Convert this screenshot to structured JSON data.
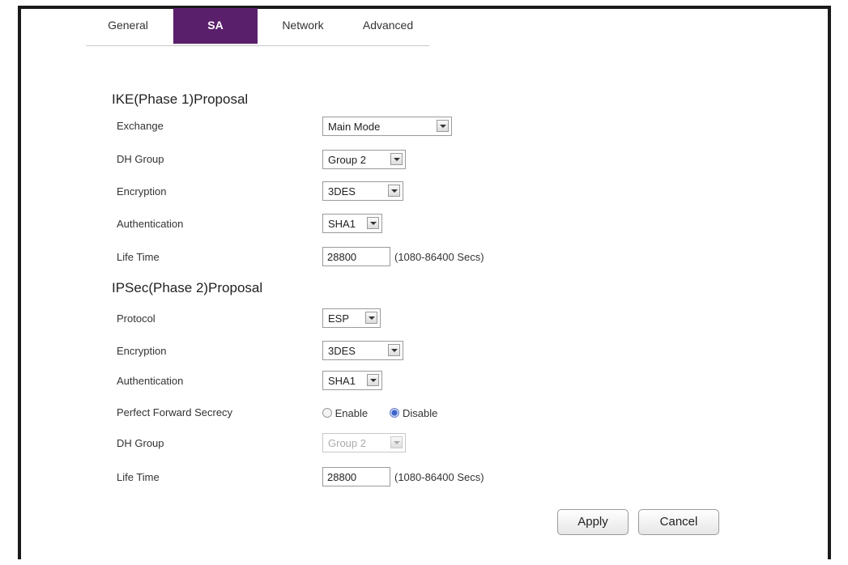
{
  "tabs": [
    {
      "label": "General",
      "active": false
    },
    {
      "label": "SA",
      "active": true
    },
    {
      "label": "Network",
      "active": false
    },
    {
      "label": "Advanced",
      "active": false
    }
  ],
  "ike": {
    "title": "IKE(Phase 1)Proposal",
    "exchange": {
      "label": "Exchange",
      "value": "Main Mode"
    },
    "dh_group": {
      "label": "DH Group",
      "value": "Group 2"
    },
    "encryption": {
      "label": "Encryption",
      "value": "3DES"
    },
    "authentication": {
      "label": "Authentication",
      "value": "SHA1"
    },
    "life_time": {
      "label": "Life Time",
      "value": "28800",
      "hint": "(1080-86400 Secs)"
    }
  },
  "ipsec": {
    "title": "IPSec(Phase 2)Proposal",
    "protocol": {
      "label": "Protocol",
      "value": "ESP"
    },
    "encryption": {
      "label": "Encryption",
      "value": "3DES"
    },
    "authentication": {
      "label": "Authentication",
      "value": "SHA1"
    },
    "pfs": {
      "label": "Perfect Forward Secrecy",
      "enable_label": "Enable",
      "disable_label": "Disable",
      "selected": "Disable"
    },
    "dh_group": {
      "label": "DH Group",
      "value": "Group 2",
      "disabled": true
    },
    "life_time": {
      "label": "Life Time",
      "value": "28800",
      "hint": "(1080-86400 Secs)"
    }
  },
  "buttons": {
    "apply": "Apply",
    "cancel": "Cancel"
  },
  "colors": {
    "tab_active_bg": "#5a1f6b",
    "radio_selected": "#3a62c8"
  }
}
